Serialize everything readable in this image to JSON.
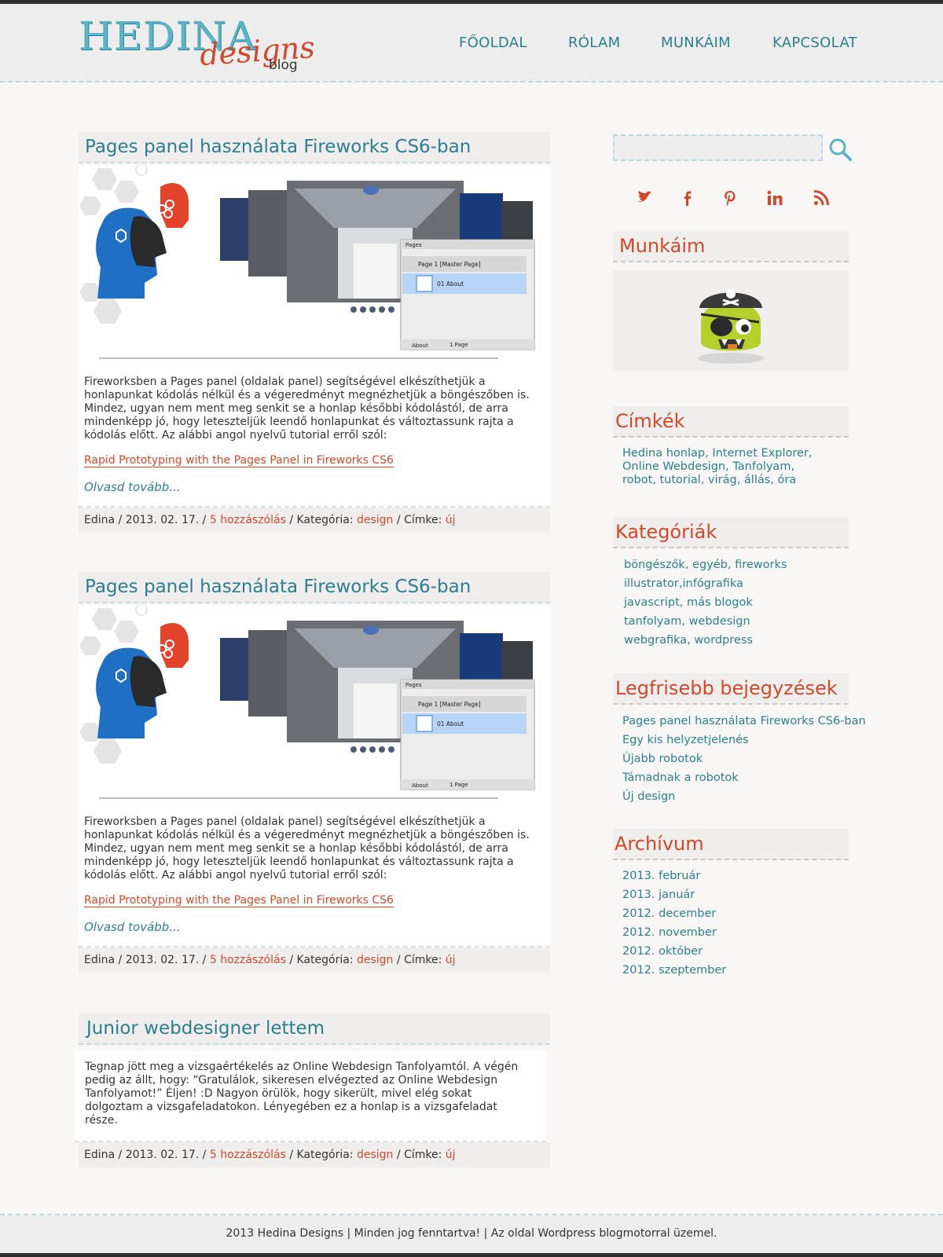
{
  "logo": {
    "main": "HEDINA",
    "sub": "designs",
    "blog": "blog"
  },
  "nav": [
    {
      "label": "FŐOLDAL"
    },
    {
      "label": "RÓLAM"
    },
    {
      "label": "MUNKÁIM"
    },
    {
      "label": "KAPCSOLAT"
    }
  ],
  "posts": [
    {
      "title": "Pages panel használata Fireworks CS6-ban",
      "body": "Fireworksben a Pages panel (oldalak panel) segítségével elkészíthetjük a honlapunkat kódolás nélkül és a végeredményt megnézhetjük a böngészőben is. Mindez, ugyan nem ment meg senkit se a honlap későbbi kódolástól, de arra mindenképp jó, hogy leteszteljük leendő honlapunkat és változtassunk rajta a kódolás előtt. Az alábbi angol nyelvű tutorial erről szól:",
      "link": "Rapid Prototyping with the Pages Panel in Fireworks CS6",
      "more": "Olvasd tovább...",
      "meta": {
        "author": "Edina",
        "date": "2013. 02. 17.",
        "comments": "5 hozzászólás",
        "category_label": "Kategória:",
        "category": "design",
        "tag_label": "Címke:",
        "tag": "új"
      }
    },
    {
      "title": "Pages panel használata Fireworks CS6-ban",
      "body": "Fireworksben a Pages panel (oldalak panel) segítségével elkészíthetjük a honlapunkat kódolás nélkül és a végeredményt megnézhetjük a böngészőben is. Mindez, ugyan nem ment meg senkit se a honlap későbbi kódolástól, de arra mindenképp jó, hogy leteszteljük leendő honlapunkat és változtassunk rajta a kódolás előtt. Az alábbi angol nyelvű tutorial erről szól:",
      "link": "Rapid Prototyping with the Pages Panel in Fireworks CS6",
      "more": "Olvasd tovább...",
      "meta": {
        "author": "Edina",
        "date": "2013. 02. 17.",
        "comments": "5 hozzászólás",
        "category_label": "Kategória:",
        "category": "design",
        "tag_label": "Címke:",
        "tag": "új"
      }
    },
    {
      "title": "Junior webdesigner lettem",
      "body": "Tegnap jött meg a vizsgaértékelés az Online Webdesign Tanfolyamtól. A végén pedig az állt, hogy: “Gratulálok, sikeresen elvégezted az Online Webdesign Tanfolyamot!” Éljen! :D Nagyon örülök, hogy sikerült, mivel elég sokat dolgoztam a vizsgafeladatokon. Lényegében ez a honlap is a vizsgafeladat része.",
      "meta": {
        "author": "Edina",
        "date": "2013. 02. 17.",
        "comments": "5 hozzászólás",
        "category_label": "Kategória:",
        "category": "design",
        "tag_label": "Címke:",
        "tag": "új"
      }
    }
  ],
  "thumbnail": {
    "panel_title": "Pages",
    "master_page": "Page 1 [Master Page]",
    "page_item": "01  About",
    "footer_select": "About",
    "footer_count": "1 Page"
  },
  "sidebar": {
    "search_placeholder": "",
    "social": [
      "twitter-icon",
      "facebook-icon",
      "pinterest-icon",
      "linkedin-icon",
      "rss-icon"
    ],
    "munkaim_title": "Munkáim",
    "cimkek_title": "Címkék",
    "cimkek_lines": [
      "Hedina honlap, Internet Explorer,",
      "Online Webdesign, Tanfolyam,",
      "robot, tutorial, virág, állás, óra"
    ],
    "kategoriak_title": "Kategóriák",
    "kategoriak": [
      "böngészők, egyéb, fireworks",
      "illustrator,infógrafika",
      "javascript, más blogok",
      "tanfolyam, webdesign",
      "webgrafika, wordpress"
    ],
    "legfrisebb_title": "Legfrisebb bejegyzések",
    "legfrisebb": [
      "Pages panel használata Fireworks CS6-ban",
      "Egy kis helyzetjelenés",
      "Újabb robotok",
      "Támadnak a robotok",
      "Új design"
    ],
    "archivum_title": "Archívum",
    "archivum": [
      "2013. február",
      "2013. január",
      "2012. december",
      "2012. november",
      "2012. október",
      "2012. szeptember"
    ]
  },
  "footer": {
    "text": "2013 Hedina Designs | Minden jog fenntartva! | Az oldal Wordpress blogmotorral üzemel."
  },
  "colors": {
    "accent": "#2b7f8f",
    "highlight": "#d2482b",
    "logo": "#5ab3c7"
  }
}
